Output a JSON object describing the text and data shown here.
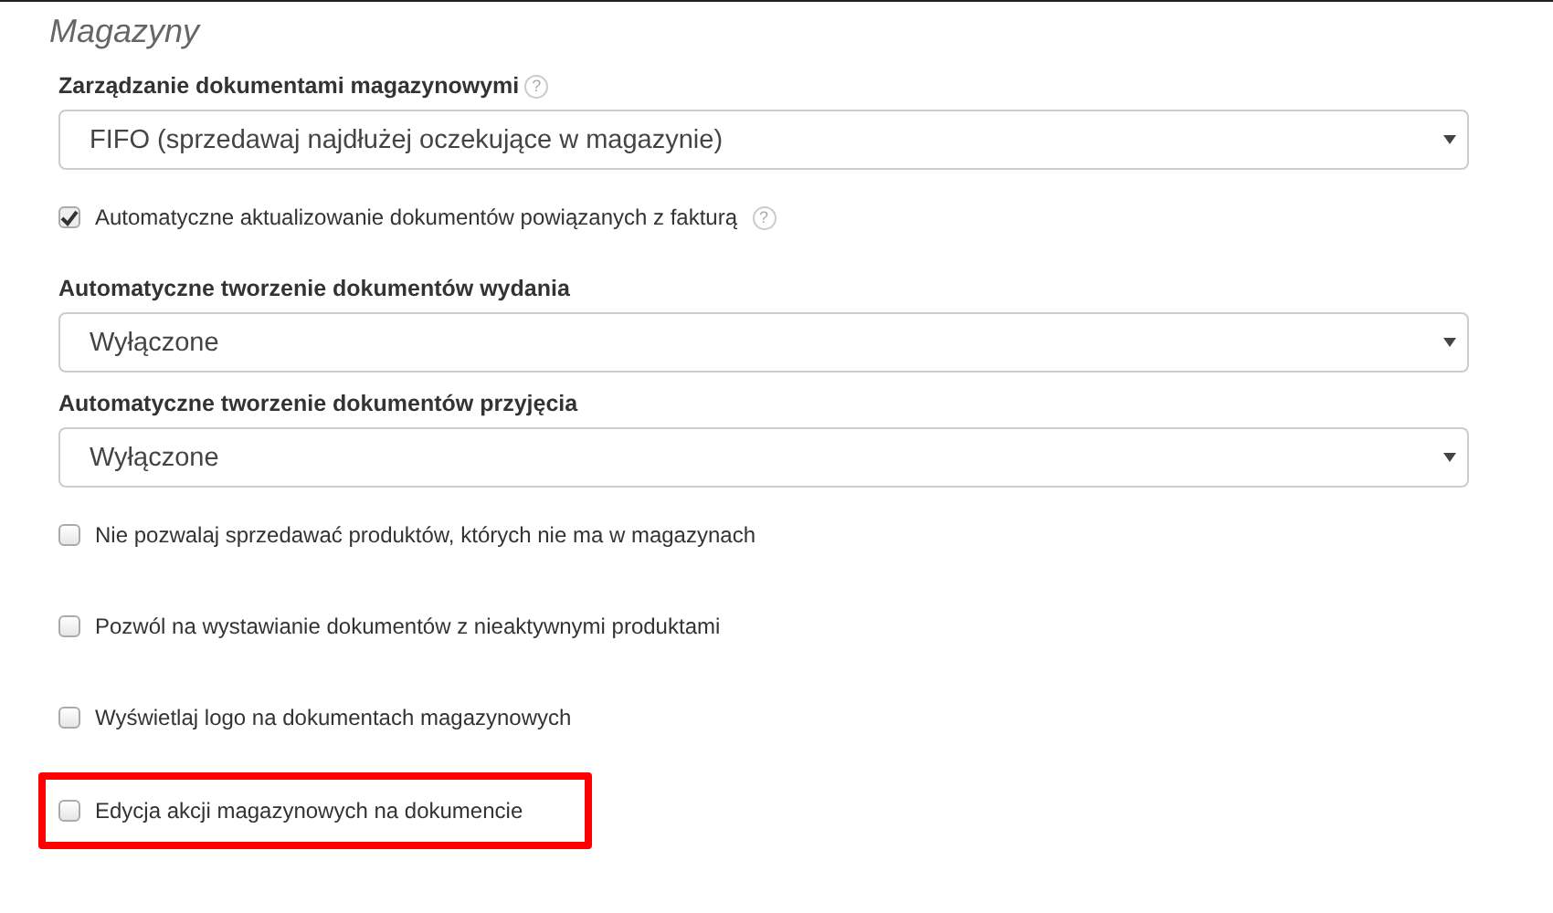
{
  "section": {
    "title": "Magazyny"
  },
  "fields": [
    {
      "kind": "select",
      "label": "Zarządzanie dokumentami magazynowymi",
      "help": "?",
      "value": "FIFO (sprzedawaj najdłużej oczekujące w magazynie)"
    },
    {
      "kind": "checkbox",
      "label": "Automatyczne aktualizowanie dokumentów powiązanych z fakturą",
      "help": "?",
      "checked": true
    },
    {
      "kind": "select",
      "label": "Automatyczne tworzenie dokumentów wydania",
      "value": "Wyłączone"
    },
    {
      "kind": "select",
      "label": "Automatyczne tworzenie dokumentów przyjęcia",
      "value": "Wyłączone"
    },
    {
      "kind": "checkbox",
      "label": "Nie pozwalaj sprzedawać produktów, których nie ma w magazynach",
      "checked": false
    },
    {
      "kind": "checkbox",
      "label": "Pozwól na wystawianie dokumentów z nieaktywnymi produktami",
      "checked": false
    },
    {
      "kind": "checkbox",
      "label": "Wyświetlaj logo na dokumentach magazynowych",
      "checked": false
    },
    {
      "kind": "checkbox",
      "label": "Edycja akcji magazynowych na dokumencie",
      "checked": false,
      "highlighted": true
    }
  ]
}
